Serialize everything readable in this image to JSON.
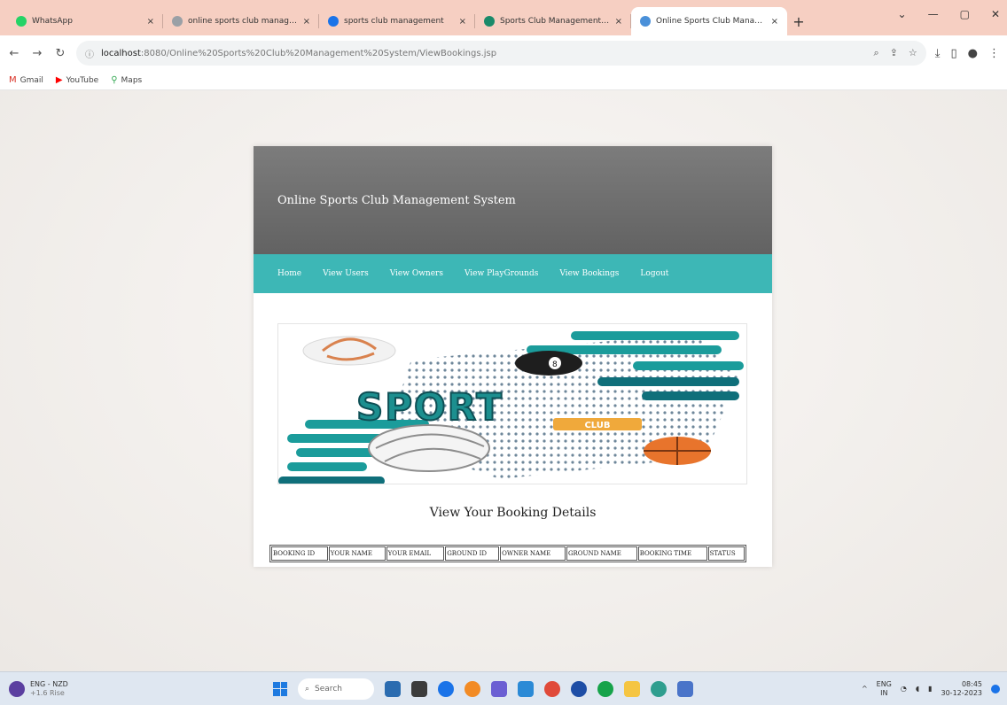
{
  "browser": {
    "tabs": [
      {
        "label": "WhatsApp",
        "color": "#25d366",
        "active": false
      },
      {
        "label": "online sports club managemen",
        "color": "#9aa0a6",
        "active": false
      },
      {
        "label": "sports club management",
        "color": "#1a73e8",
        "active": false
      },
      {
        "label": "Sports Club Management Syst",
        "color": "#1a8a6a",
        "active": false
      },
      {
        "label": "Online Sports Club Managemen",
        "color": "#4a90d9",
        "active": true
      }
    ],
    "close_glyph": "×",
    "new_tab_glyph": "+",
    "url_host": "localhost",
    "url_path": ":8080/Online%20Sports%20Club%20Management%20System/ViewBookings.jsp",
    "bookmarks": [
      {
        "label": "Gmail",
        "icon": "gmail-icon"
      },
      {
        "label": "YouTube",
        "icon": "youtube-icon"
      },
      {
        "label": "Maps",
        "icon": "maps-icon"
      }
    ]
  },
  "site": {
    "title": "Online Sports Club Management System",
    "nav": [
      "Home",
      "View Users",
      "View Owners",
      "View PlayGrounds",
      "View Bookings",
      "Logout"
    ],
    "banner_text": "SPORT",
    "banner_sub": "CLUB"
  },
  "bookings": {
    "heading": "View Your Booking Details",
    "columns": [
      "BOOKING ID",
      "YOUR NAME",
      "YOUR EMAIL",
      "GROUND ID",
      "OWNER NAME",
      "GROUND NAME",
      "BOOKING TIME",
      "STATUS"
    ],
    "rows": []
  },
  "taskbar": {
    "left_line1": "ENG - NZD",
    "left_line2": "+1.6 Rise",
    "search_placeholder": "Search",
    "lang": "ENG",
    "lang2": "IN",
    "time": "08:45",
    "date": "30-12-2023"
  },
  "colors": {
    "header_bg": "#6b6b6b",
    "nav_bg": "#3db7b6",
    "tab_strip": "#f6cfc2"
  }
}
